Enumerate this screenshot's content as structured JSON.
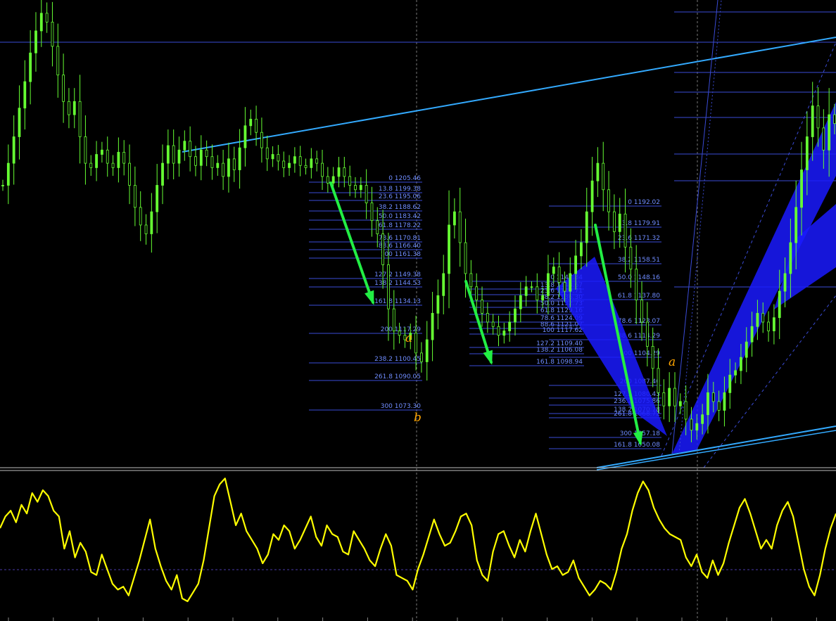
{
  "colors": {
    "background": "#000000",
    "candle": "#66ff33",
    "fib_line": "#3a4bd6",
    "fib_text": "#6f8cff",
    "trend_line": "#33aaff",
    "channel_fill": "#1a1aff",
    "arrow": "#22ee44",
    "oscillator": "#ffff00",
    "annotation": "#ffa500",
    "separator": "#c0c0c0"
  },
  "chart_data": [
    {
      "type": "line",
      "chart_kind": "candlestick price chart",
      "ylim": [
        1040,
        1252
      ],
      "grid": false,
      "close": [
        1168,
        1178,
        1190,
        1203,
        1215,
        1228,
        1238,
        1246,
        1242,
        1231,
        1218,
        1206,
        1200,
        1206,
        1190,
        1178,
        1176,
        1182,
        1184,
        1178,
        1176,
        1183,
        1178,
        1168,
        1158,
        1150,
        1146,
        1156,
        1168,
        1178,
        1186,
        1178,
        1184,
        1188,
        1181,
        1177,
        1184,
        1181,
        1176,
        1178,
        1172,
        1180,
        1175,
        1185,
        1195,
        1198,
        1192,
        1185,
        1180,
        1182,
        1179,
        1176,
        1178,
        1181,
        1177,
        1176,
        1180,
        1178,
        1172,
        1169,
        1172,
        1176,
        1172,
        1168,
        1166,
        1168,
        1160,
        1152,
        1146,
        1132,
        1112,
        1102,
        1100,
        1098,
        1101,
        1092,
        1088,
        1098,
        1110,
        1118,
        1128,
        1150,
        1156,
        1142,
        1128,
        1122,
        1116,
        1110,
        1106,
        1104,
        1100,
        1102,
        1106,
        1112,
        1118,
        1122,
        1122,
        1116,
        1118,
        1128,
        1131,
        1124,
        1120,
        1128,
        1136,
        1142,
        1156,
        1170,
        1178,
        1166,
        1156,
        1147,
        1155,
        1140,
        1130,
        1116,
        1106,
        1095,
        1085,
        1074,
        1068,
        1076,
        1068,
        1070,
        1062,
        1057,
        1060,
        1064,
        1074,
        1070,
        1066,
        1074,
        1082,
        1084,
        1090,
        1097,
        1104,
        1110,
        1106,
        1102,
        1108,
        1120,
        1128,
        1142,
        1158,
        1175,
        1190,
        1204,
        1194,
        1184,
        1200,
        1196
      ],
      "fib_sets": [
        {
          "levels": [
            {
              "label": "0 1205.46"
            },
            {
              "label": "13.8 1199.38"
            },
            {
              "label": "23.6 1195.06"
            },
            {
              "label": "38.2 1188.62"
            },
            {
              "label": "50.0 1183.42"
            },
            {
              "label": "61.8 1178.22"
            },
            {
              "label": "78.6 1170.81"
            },
            {
              "label": "88.6 1166.40"
            },
            {
              "label": "100 1161.38"
            },
            {
              "label": "127.2 1149.38"
            },
            {
              "label": "138.2 1144.53"
            },
            {
              "label": "161.8 1134.13"
            },
            {
              "label": "200 1117.29"
            },
            {
              "label": "238.2 1100.45"
            },
            {
              "label": "261.8 1090.05"
            },
            {
              "label": "300 1073.30"
            }
          ]
        },
        {
          "levels": [
            {
              "label": "0 1147.84"
            },
            {
              "label": "13.8 1143.67"
            },
            {
              "label": "23.6 1140.71"
            },
            {
              "label": "38.2 1136.30"
            },
            {
              "label": "50.0 1132.73"
            },
            {
              "label": "61.8 1129.16"
            },
            {
              "label": "78.6 1124.09"
            },
            {
              "label": "88.6 1121.07"
            },
            {
              "label": "100 1117.62"
            },
            {
              "label": "127.2 1109.40"
            },
            {
              "label": "138.2 1106.08"
            },
            {
              "label": "161.8 1098.94"
            }
          ]
        },
        {
          "levels": [
            {
              "label": "0 1192.02"
            },
            {
              "label": "13.8 1179.91"
            },
            {
              "label": "23.6 1171.32"
            },
            {
              "label": "38.2 1158.51"
            },
            {
              "label": "50.0 1148.16"
            },
            {
              "label": "61.8 1137.80"
            },
            {
              "label": "78.6 1123.07"
            },
            {
              "label": "88.6 1114.29"
            },
            {
              "label": "100 1104.29"
            },
            {
              "label": "127.2 1080.43"
            },
            {
              "label": "138.2 1070.78"
            },
            {
              "label": "161.8 1050.08"
            },
            {
              "label": "200 1087.40"
            },
            {
              "label": "236.2 1075.86"
            },
            {
              "label": "261.8 1068.72"
            },
            {
              "label": "300 1057.18"
            }
          ]
        }
      ],
      "annotations": [
        "a",
        "b",
        "a"
      ]
    },
    {
      "type": "line",
      "chart_kind": "oscillator",
      "ylim": [
        0,
        100
      ],
      "grid": false,
      "values": [
        62,
        70,
        74,
        66,
        78,
        72,
        86,
        80,
        88,
        84,
        74,
        70,
        48,
        60,
        42,
        52,
        46,
        32,
        30,
        44,
        34,
        24,
        20,
        22,
        16,
        28,
        40,
        54,
        68,
        48,
        36,
        26,
        20,
        30,
        14,
        12,
        18,
        24,
        40,
        62,
        84,
        92,
        96,
        80,
        64,
        72,
        60,
        54,
        48,
        38,
        44,
        58,
        54,
        64,
        60,
        48,
        54,
        62,
        70,
        56,
        50,
        64,
        58,
        56,
        46,
        44,
        60,
        54,
        48,
        40,
        36,
        48,
        58,
        50,
        30,
        28,
        26,
        20,
        34,
        44,
        56,
        68,
        58,
        50,
        52,
        60,
        70,
        72,
        64,
        40,
        30,
        26,
        46,
        58,
        60,
        50,
        42,
        54,
        46,
        60,
        72,
        58,
        44,
        34,
        36,
        30,
        32,
        40,
        28,
        22,
        16,
        20,
        26,
        24,
        20,
        32,
        48,
        58,
        74,
        86,
        94,
        88,
        76,
        68,
        62,
        58,
        56,
        54,
        42,
        36,
        44,
        32,
        28,
        40,
        30,
        38,
        52,
        64,
        76,
        82,
        72,
        60,
        48,
        54,
        48,
        64,
        74,
        80,
        70,
        52,
        34,
        22,
        16,
        30,
        48,
        62,
        72
      ]
    }
  ]
}
